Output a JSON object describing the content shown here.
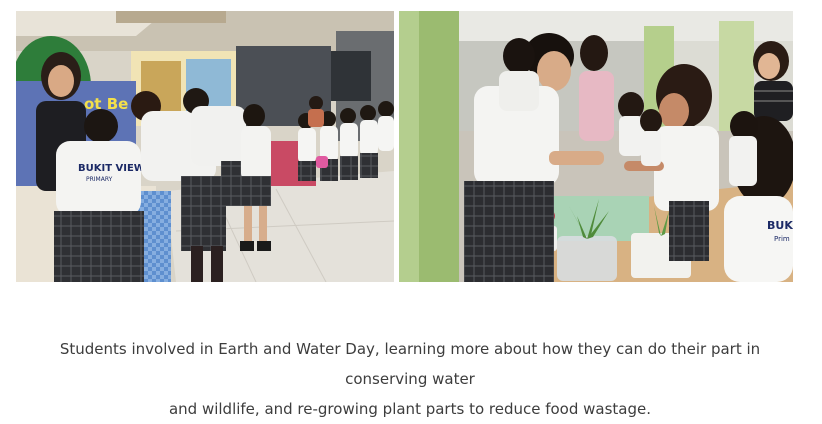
{
  "photos": [
    {
      "name": "students-at-exhibition-stand",
      "shirt_lettering": [
        "BUKIT VIEW",
        "PRIMARY"
      ],
      "banner_lettering": "ot Be"
    },
    {
      "name": "students-regrowing-plants",
      "shirt_lettering": [
        "BUKIT",
        "Prim"
      ]
    }
  ],
  "caption": {
    "line1": "Students involved in Earth and Water Day, learning more about how they can do their part in conserving water",
    "line2": "and wildlife, and re-growing plant parts to reduce food wastage."
  }
}
